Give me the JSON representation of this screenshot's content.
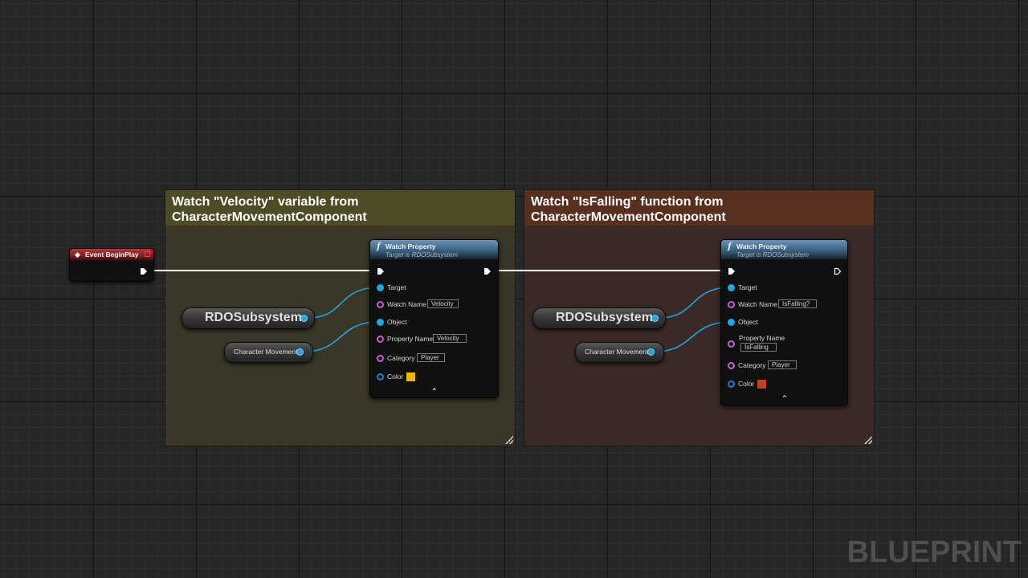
{
  "comments": [
    {
      "line1": "Watch \"Velocity\" variable from",
      "line2": "CharacterMovementComponent",
      "header_color": "#4f4b26",
      "body_color": "#3a3726"
    },
    {
      "line1": "Watch \"IsFalling\" function from",
      "line2": "CharacterMovementComponent",
      "header_color": "#57301f",
      "body_color": "#3a2a25"
    }
  ],
  "event_node": {
    "title": "Event BeginPlay",
    "icon": "event-diamond-icon"
  },
  "watch_nodes": [
    {
      "title": "Watch Property",
      "subtitle": "Target is RDOSubsystem",
      "pins": {
        "target": "Target",
        "watch_name": "Watch Name",
        "watch_name_value": "Velocity",
        "object": "Object",
        "property_name": "Property Name",
        "property_name_value": "Velocity",
        "category": "Category",
        "category_value": "Player",
        "color": "Color",
        "color_value": "#f5b400"
      }
    },
    {
      "title": "Watch Property",
      "subtitle": "Target is RDOSubsystem",
      "pins": {
        "target": "Target",
        "watch_name": "Watch Name",
        "watch_name_value": "IsFalling?",
        "object": "Object",
        "property_name": "Property Name",
        "property_name_value": "IsFalling",
        "category": "Category",
        "category_value": "Player",
        "color": "Color",
        "color_value": "#c8411a"
      }
    }
  ],
  "variable_nodes": {
    "subsystem_label": "RDOSubsystem",
    "movement_label": "Character Movement"
  },
  "watermark": "BLUEPRINT",
  "colors": {
    "object_pin": "#1fa6e6",
    "string_pin": "#c45fd4",
    "exec_wire": "#ffffff",
    "graph_bg": "#262626"
  }
}
